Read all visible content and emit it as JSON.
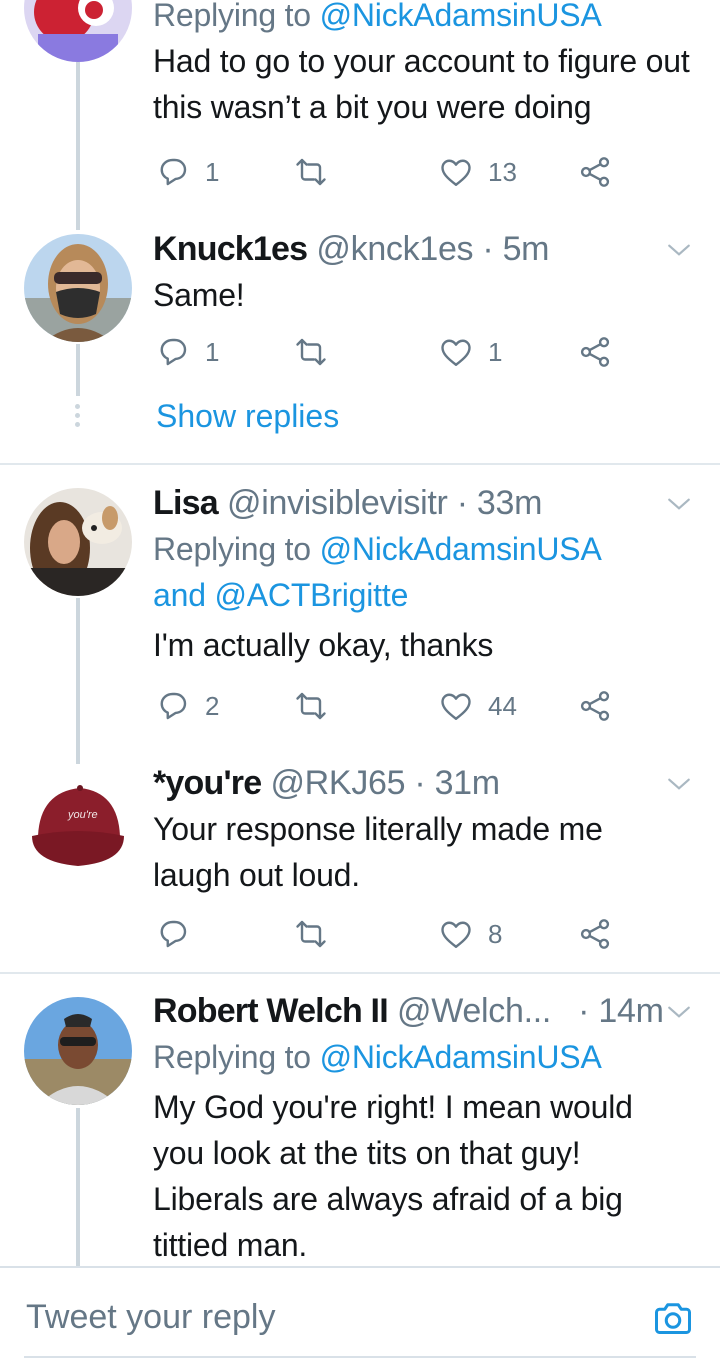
{
  "tweets": [
    {
      "reply_prefix": "Replying to ",
      "reply_to": "@NickAdamsinUSA",
      "text": "Had to go to your account to figure out this wasn’t a bit you were doing",
      "replies": "1",
      "retweets": "",
      "likes": "13"
    },
    {
      "name": "Knuck1es",
      "handle": "@knck1es",
      "sep": " · ",
      "time": "5m",
      "text": "Same!",
      "replies": "1",
      "retweets": "",
      "likes": "1",
      "show_replies": "Show replies"
    },
    {
      "name": "Lisa",
      "handle": "@invisiblevisitr",
      "sep": " · ",
      "time": "33m",
      "reply_prefix": "Replying to ",
      "reply_to": "@NickAdamsinUSA",
      "reply_and": "and ",
      "reply_to2": "@ACTBrigitte",
      "text": "I'm actually okay, thanks",
      "replies": "2",
      "retweets": "",
      "likes": "44"
    },
    {
      "name": "*you're",
      "handle": "@RKJ65",
      "sep": " · ",
      "time": "31m",
      "avatar_text": "you're",
      "text": "Your response literally made me laugh out loud.",
      "replies": "",
      "retweets": "",
      "likes": "8"
    },
    {
      "name": "Robert Welch II",
      "handle": "@Welch...",
      "sep": " · ",
      "time": "14m",
      "reply_prefix": "Replying to ",
      "reply_to": "@NickAdamsinUSA",
      "text": "My God you're right! I mean would you look at the tits on that guy! Liberals are always afraid of a big tittied man."
    }
  ],
  "compose": {
    "placeholder": "Tweet your reply"
  },
  "colors": {
    "link": "#1b95e0",
    "muted": "#657786",
    "text": "#14171a",
    "thread_line": "#ccd6dd"
  },
  "icons": [
    "reply-icon",
    "retweet-icon",
    "like-icon",
    "share-icon",
    "chevron-down-icon",
    "camera-icon"
  ]
}
